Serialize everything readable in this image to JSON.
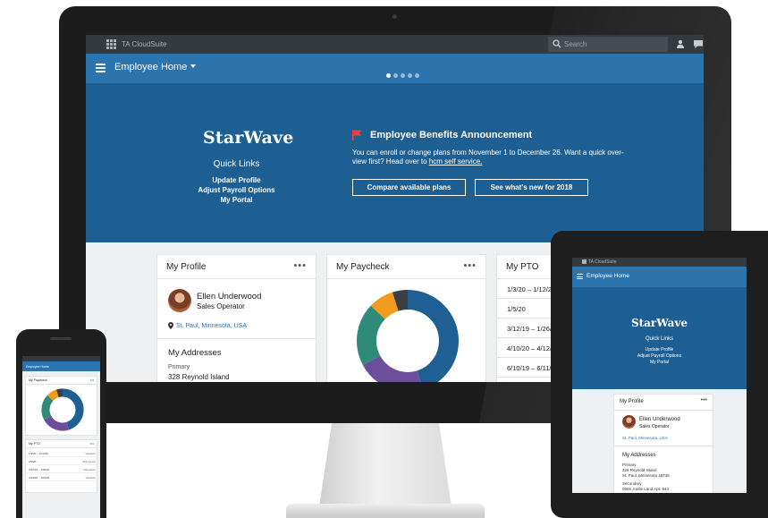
{
  "app": {
    "brand": "TA CloudSuite",
    "search_placeholder": "Search",
    "nav_title": "Employee Home"
  },
  "hero": {
    "logo": "StarWave",
    "quick_links_title": "Quick Links",
    "quick_links": [
      "Update Profile",
      "Adjust Payroll Options",
      "My Portal"
    ],
    "announcement_title": "Employee Benefits Announcement",
    "announcement_text": "You can enroll or change plans from November 1 to December 26. Want a quick over-view first? Head over to ",
    "announcement_link": "hcm self service.",
    "buttons": [
      "Compare available plans",
      "See what's new for 2018"
    ]
  },
  "profile": {
    "title": "My Profile",
    "more": "•••",
    "name": "Ellen Underwood",
    "role": "Sales Operator",
    "location": "St. Paul, Minnesota, USA",
    "addresses_title": "My Addresses",
    "primary_label": "Primary",
    "primary_address": "328 Reynold Island",
    "primary_city": "St. Paul, Minnesota 45745",
    "secondary_label": "Secondary",
    "secondary_address": "0665 Joelle Land Apt. 844"
  },
  "paycheck": {
    "title": "My Paycheck",
    "more": "•••",
    "segments": [
      {
        "value": 45,
        "color": "#1f5f93"
      },
      {
        "value": 22,
        "color": "#6d4e9b"
      },
      {
        "value": 20,
        "color": "#2f8a77"
      },
      {
        "value": 8,
        "color": "#f39b1c"
      },
      {
        "value": 5,
        "color": "#3b3f44"
      }
    ]
  },
  "pto": {
    "title": "My PTO",
    "more": "•••",
    "rows": [
      {
        "dates": "1/3/20 – 1/12/20",
        "type": "Vacation"
      },
      {
        "dates": "1/5/20",
        "type": "Sick Leave"
      },
      {
        "dates": "3/12/19 – 1/26/20",
        "type": "Education"
      },
      {
        "dates": "4/10/20 – 4/12/20",
        "type": "Vacation"
      },
      {
        "dates": "6/10/19 – 6/11/19",
        "type": "Vacation"
      }
    ]
  },
  "phone": {
    "pto_rows": [
      {
        "dates": "1/3/20 – 1/12/20",
        "type": "Vacation"
      },
      {
        "dates": "1/5/20",
        "type": "Sick Leave"
      },
      {
        "dates": "3/12/19 – 1/26/20",
        "type": "Education"
      },
      {
        "dates": "4/10/20 – 4/12/20",
        "type": "Vacation"
      }
    ]
  }
}
